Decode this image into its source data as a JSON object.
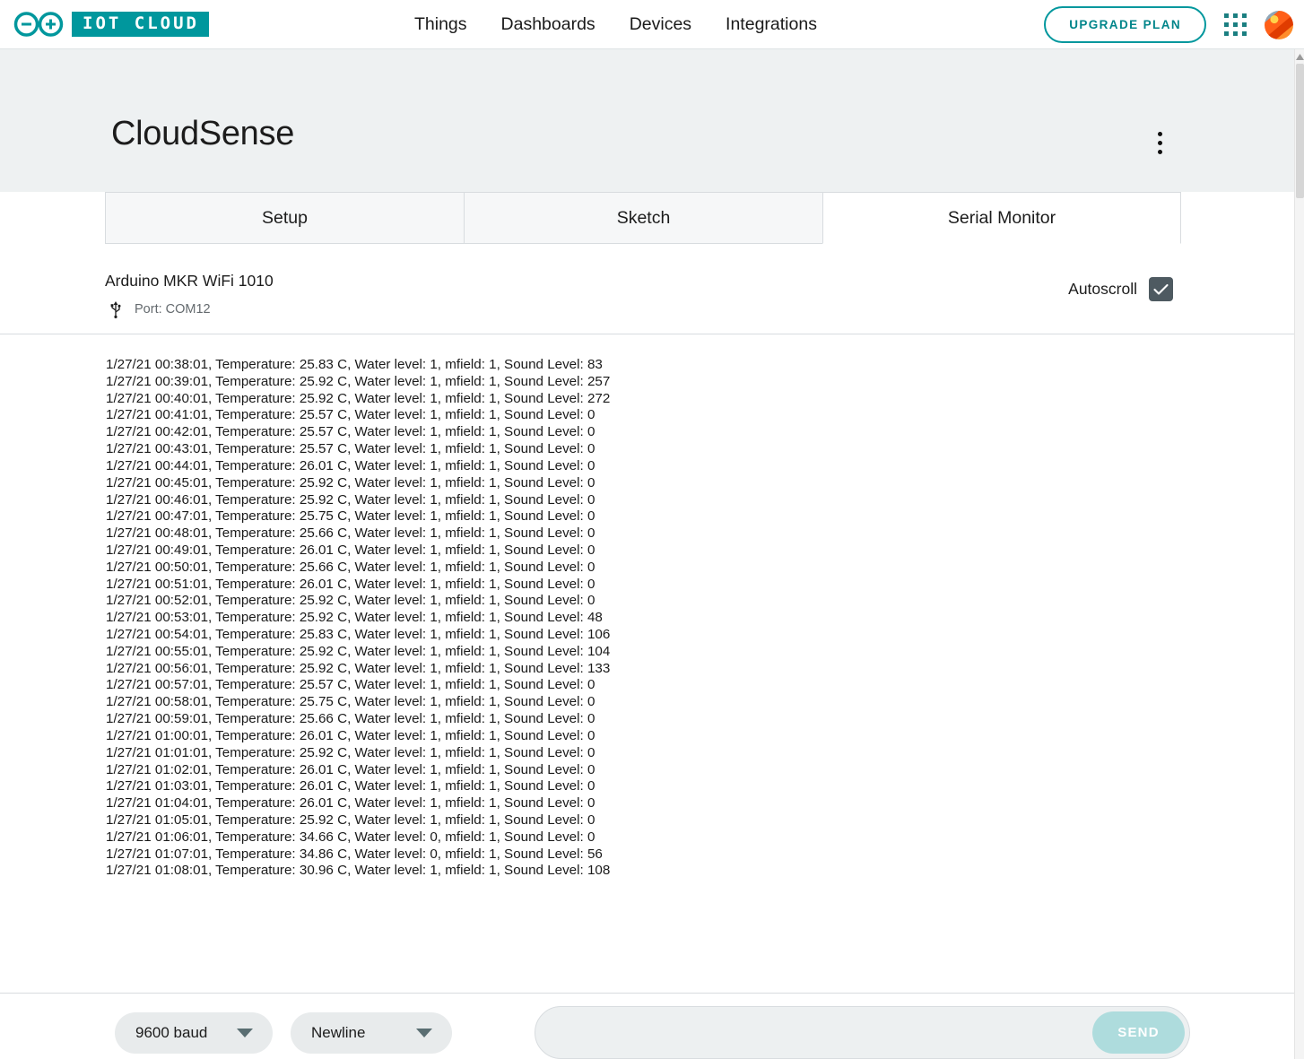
{
  "header": {
    "brand_badge": "IOT CLOUD",
    "logo_icon": "arduino-infinity-logo",
    "nav": [
      {
        "label": "Things"
      },
      {
        "label": "Dashboards"
      },
      {
        "label": "Devices"
      },
      {
        "label": "Integrations"
      }
    ],
    "upgrade_label": "UPGRADE PLAN",
    "apps_icon": "grid-apps-icon",
    "avatar_icon": "user-avatar",
    "accent_color": "#00979d"
  },
  "thing": {
    "title": "CloudSense",
    "menu_icon": "kebab-menu-icon"
  },
  "tabs": [
    {
      "label": "Setup",
      "active": false
    },
    {
      "label": "Sketch",
      "active": false
    },
    {
      "label": "Serial Monitor",
      "active": true
    }
  ],
  "device": {
    "name": "Arduino MKR WiFi 1010",
    "port_icon": "usb-icon",
    "port": "Port: COM12",
    "autoscroll_label": "Autoscroll",
    "autoscroll_checked": true,
    "checkbox_color": "#4e5a61"
  },
  "serial_log": {
    "lines": [
      "1/27/21 00:38:01, Temperature: 25.83 C, Water level: 1, mfield: 1, Sound Level: 83",
      "1/27/21 00:39:01, Temperature: 25.92 C, Water level: 1, mfield: 1, Sound Level: 257",
      "1/27/21 00:40:01, Temperature: 25.92 C, Water level: 1, mfield: 1, Sound Level: 272",
      "1/27/21 00:41:01, Temperature: 25.57 C, Water level: 1, mfield: 1, Sound Level: 0",
      "1/27/21 00:42:01, Temperature: 25.57 C, Water level: 1, mfield: 1, Sound Level: 0",
      "1/27/21 00:43:01, Temperature: 25.57 C, Water level: 1, mfield: 1, Sound Level: 0",
      "1/27/21 00:44:01, Temperature: 26.01 C, Water level: 1, mfield: 1, Sound Level: 0",
      "1/27/21 00:45:01, Temperature: 25.92 C, Water level: 1, mfield: 1, Sound Level: 0",
      "1/27/21 00:46:01, Temperature: 25.92 C, Water level: 1, mfield: 1, Sound Level: 0",
      "1/27/21 00:47:01, Temperature: 25.75 C, Water level: 1, mfield: 1, Sound Level: 0",
      "1/27/21 00:48:01, Temperature: 25.66 C, Water level: 1, mfield: 1, Sound Level: 0",
      "1/27/21 00:49:01, Temperature: 26.01 C, Water level: 1, mfield: 1, Sound Level: 0",
      "1/27/21 00:50:01, Temperature: 25.66 C, Water level: 1, mfield: 1, Sound Level: 0",
      "1/27/21 00:51:01, Temperature: 26.01 C, Water level: 1, mfield: 1, Sound Level: 0",
      "1/27/21 00:52:01, Temperature: 25.92 C, Water level: 1, mfield: 1, Sound Level: 0",
      "1/27/21 00:53:01, Temperature: 25.92 C, Water level: 1, mfield: 1, Sound Level: 48",
      "1/27/21 00:54:01, Temperature: 25.83 C, Water level: 1, mfield: 1, Sound Level: 106",
      "1/27/21 00:55:01, Temperature: 25.92 C, Water level: 1, mfield: 1, Sound Level: 104",
      "1/27/21 00:56:01, Temperature: 25.92 C, Water level: 1, mfield: 1, Sound Level: 133",
      "1/27/21 00:57:01, Temperature: 25.57 C, Water level: 1, mfield: 1, Sound Level: 0",
      "1/27/21 00:58:01, Temperature: 25.75 C, Water level: 1, mfield: 1, Sound Level: 0",
      "1/27/21 00:59:01, Temperature: 25.66 C, Water level: 1, mfield: 1, Sound Level: 0",
      "1/27/21 01:00:01, Temperature: 26.01 C, Water level: 1, mfield: 1, Sound Level: 0",
      "1/27/21 01:01:01, Temperature: 25.92 C, Water level: 1, mfield: 1, Sound Level: 0",
      "1/27/21 01:02:01, Temperature: 26.01 C, Water level: 1, mfield: 1, Sound Level: 0",
      "1/27/21 01:03:01, Temperature: 26.01 C, Water level: 1, mfield: 1, Sound Level: 0",
      "1/27/21 01:04:01, Temperature: 26.01 C, Water level: 1, mfield: 1, Sound Level: 0",
      "1/27/21 01:05:01, Temperature: 25.92 C, Water level: 1, mfield: 1, Sound Level: 0",
      "1/27/21 01:06:01, Temperature: 34.66 C, Water level: 0, mfield: 1, Sound Level: 0",
      "1/27/21 01:07:01, Temperature: 34.86 C, Water level: 0, mfield: 1, Sound Level: 56",
      "1/27/21 01:08:01, Temperature: 30.96 C, Water level: 1, mfield: 1, Sound Level: 108"
    ]
  },
  "toolbar": {
    "baud_value": "9600 baud",
    "line_ending_value": "Newline",
    "message_value": "",
    "message_placeholder": "",
    "send_label": "SEND",
    "send_color": "#aedcdd",
    "caret_icon": "chevron-down-icon"
  }
}
